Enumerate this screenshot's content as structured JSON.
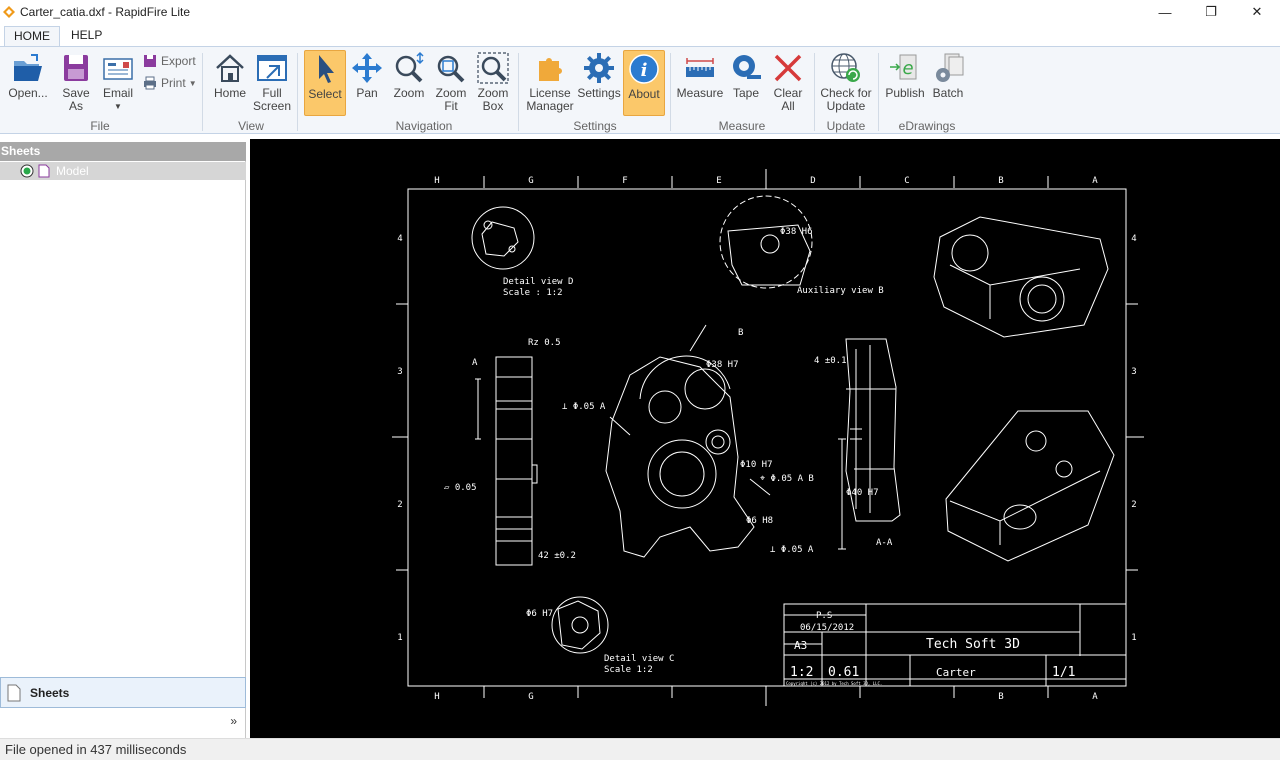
{
  "window": {
    "title": "Carter_catia.dxf - RapidFire Lite",
    "min_glyph": "—",
    "max_glyph": "❐",
    "close_glyph": "✕"
  },
  "tabs": [
    {
      "label": "HOME"
    },
    {
      "label": "HELP"
    }
  ],
  "ribbon": {
    "open": "Open...",
    "save_as_1": "Save",
    "save_as_2": "As",
    "email": "Email",
    "export": "Export",
    "print": "Print",
    "home": "Home",
    "full_1": "Full",
    "full_2": "Screen",
    "select": "Select",
    "pan": "Pan",
    "zoom": "Zoom",
    "zoom_fit_1": "Zoom",
    "zoom_fit_2": "Fit",
    "zoom_box_1": "Zoom",
    "zoom_box_2": "Box",
    "license_1": "License",
    "license_2": "Manager",
    "settings": "Settings",
    "about": "About",
    "measure": "Measure",
    "tape": "Tape",
    "clear_1": "Clear",
    "clear_2": "All",
    "check_1": "Check for",
    "check_2": "Update",
    "publish": "Publish",
    "batch": "Batch",
    "groups": {
      "file": "File",
      "view": "View",
      "navigation": "Navigation",
      "settings": "Settings",
      "measure": "Measure",
      "update": "Update",
      "edrawings": "eDrawings"
    }
  },
  "left_pane": {
    "header": "Sheets",
    "model": "Model",
    "bottom_tab": "Sheets",
    "expand": "»"
  },
  "drawing": {
    "col_labels": [
      "H",
      "G",
      "F",
      "E",
      "D",
      "C",
      "B",
      "A"
    ],
    "row_labels": [
      "4",
      "3",
      "2",
      "1"
    ],
    "detail_d": "Detail view D",
    "detail_d_scale": "Scale :  1:2",
    "aux_b": "Auxiliary view B",
    "detail_c": "Detail view C",
    "detail_c_scale": "Scale 1:2",
    "section": "A-A",
    "dim_rz": "Rz 0.5",
    "dim_38h6": "Φ38 H6",
    "dim_38h7": "Φ38 H7",
    "dim_perp1": "⊥ Φ.05 A",
    "dim_perp2": "⊥ Φ.05 A",
    "dim_pos": "⌖ Φ.05 A B",
    "dim_flat": "▱ 0.05",
    "dim_42": "42 ±0.2",
    "dim_4": "4 ±0.1",
    "dim_6h7": "Φ6 H7",
    "dim_40h7": "Φ40 H7",
    "dim_10h7": "Φ10 H7",
    "dim_6h8": "Φ6 H8",
    "datum_a": "A",
    "datum_b": "B",
    "tb_name": "P.S",
    "tb_date": "06/15/2012",
    "tb_size": "A3",
    "tb_company": "Tech Soft 3D",
    "tb_scale": "1:2",
    "tb_weight": "0.61",
    "tb_part": "Carter",
    "tb_sheet": "1/1",
    "tb_copyright": "Copyright (c) 2012 by Tech Soft 3D, LLC."
  },
  "status": {
    "text": "File opened in 437 milliseconds"
  },
  "colors": {
    "accent_active": "#fbc86a",
    "ribbon_bg": "#f3f6fa",
    "viewport_bg": "#000000"
  }
}
